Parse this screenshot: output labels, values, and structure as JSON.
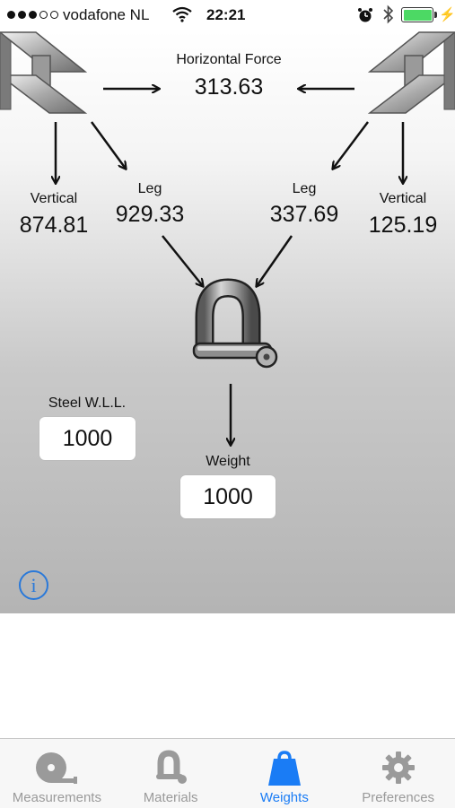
{
  "status": {
    "carrier": "vodafone NL",
    "time": "22:21",
    "signal": [
      true,
      true,
      true,
      false,
      false
    ]
  },
  "diagram": {
    "horizontal": {
      "label": "Horizontal Force",
      "value": "313.63"
    },
    "left": {
      "vertical_label": "Vertical",
      "vertical_value": "874.81",
      "leg_label": "Leg",
      "leg_value": "929.33"
    },
    "right": {
      "vertical_label": "Vertical",
      "vertical_value": "125.19",
      "leg_label": "Leg",
      "leg_value": "337.69"
    },
    "steel_wll": {
      "label": "Steel W.L.L.",
      "value": "1000"
    },
    "weight": {
      "label": "Weight",
      "value": "1000"
    },
    "info_icon": "i"
  },
  "tabs": [
    {
      "label": "Measurements",
      "icon": "tape-measure-icon",
      "active": false
    },
    {
      "label": "Materials",
      "icon": "shackle-icon",
      "active": false
    },
    {
      "label": "Weights",
      "icon": "weight-icon",
      "active": true
    },
    {
      "label": "Preferences",
      "icon": "gear-icon",
      "active": false
    }
  ],
  "colors": {
    "accent": "#1a7cf5",
    "inactive_tab": "#9a9a9a",
    "battery": "#4cd964",
    "info": "#2a79d9"
  }
}
